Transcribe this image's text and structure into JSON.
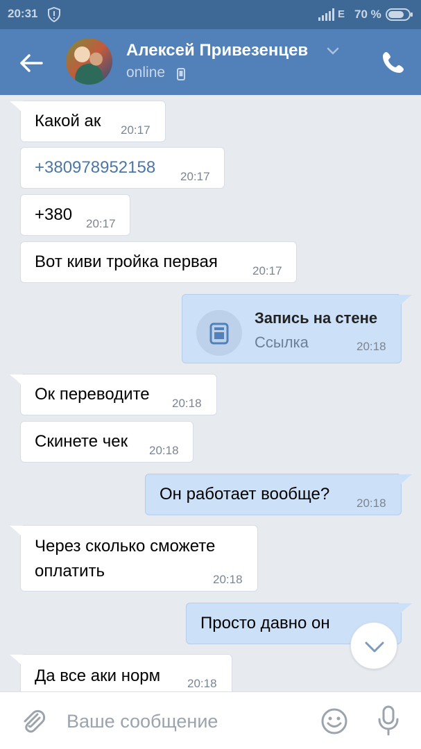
{
  "status_bar": {
    "time": "20:31",
    "network": "E",
    "battery": "70 %"
  },
  "header": {
    "contact_name": "Алексей Привезенцев",
    "status": "online"
  },
  "messages": [
    {
      "direction": "in",
      "text": "Какой ак",
      "time": "20:17"
    },
    {
      "direction": "in",
      "text": "+380978952158",
      "time": "20:17",
      "is_link": true
    },
    {
      "direction": "in",
      "text": "+380",
      "time": "20:17"
    },
    {
      "direction": "in",
      "text": "Вот киви тройка первая",
      "time": "20:17"
    },
    {
      "direction": "out",
      "type": "wall_post",
      "title": "Запись на стене",
      "subtitle": "Ссылка",
      "time": "20:18"
    },
    {
      "direction": "in",
      "text": "Ок переводите",
      "time": "20:18"
    },
    {
      "direction": "in",
      "text": "Скинете чек",
      "time": "20:18"
    },
    {
      "direction": "out",
      "text": "Он работает вообще?",
      "time": "20:18"
    },
    {
      "direction": "in",
      "text_lines": [
        "Через сколько сможете",
        "оплатить"
      ],
      "time": "20:18"
    },
    {
      "direction": "out",
      "text": "Просто давно он",
      "time": ""
    },
    {
      "direction": "in",
      "text": "Да все аки норм",
      "time": "20:18"
    }
  ],
  "composer": {
    "placeholder": "Ваше сообщение"
  },
  "icons": {
    "back": "arrow-left-icon",
    "call": "phone-icon",
    "attach": "paperclip-icon",
    "emoji": "smiley-icon",
    "mic": "microphone-icon",
    "scroll_down": "chevron-down-icon",
    "wall_post": "document-icon"
  },
  "colors": {
    "header": "#5181b8",
    "status_bar": "#3e6996",
    "background": "#e7ebf0",
    "outgoing_bubble": "#cce0f7",
    "incoming_bubble": "#ffffff",
    "link": "#4a77a8"
  }
}
